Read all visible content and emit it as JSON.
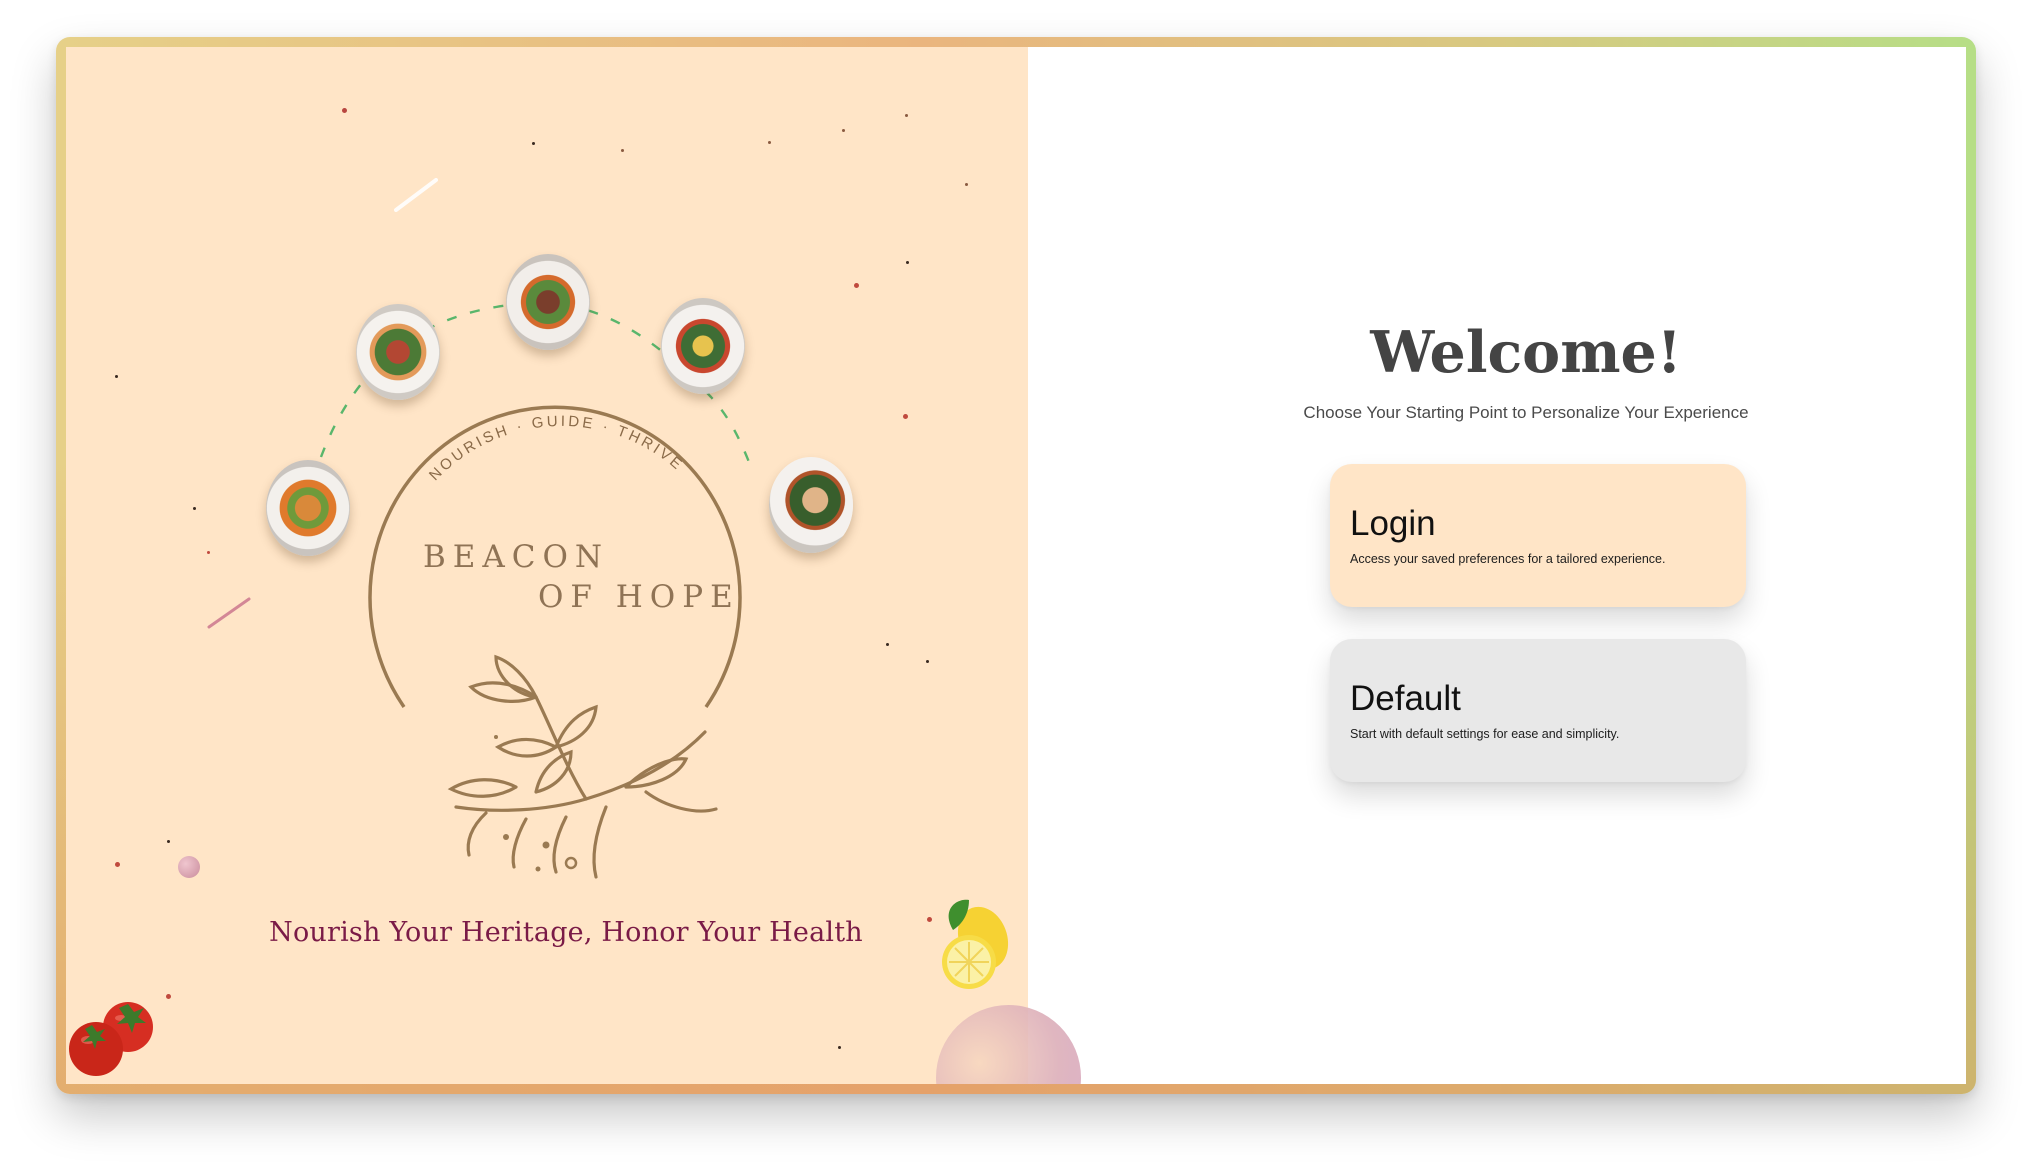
{
  "logo": {
    "brand_line1": "BEACON",
    "brand_line2": "OF HOPE",
    "arc_text": "NOURISH · GUIDE · THRIVE"
  },
  "left_panel": {
    "tagline": "Nourish Your Heritage, Honor Your Health",
    "background_color": "#ffe5c7",
    "accent_color": "#7a1b47"
  },
  "main": {
    "heading": "Welcome!",
    "subtitle": "Choose Your Starting Point to Personalize Your Experience",
    "options": [
      {
        "title": "Login",
        "description": "Access your saved preferences for a tailored experience.",
        "color": "#ffe5c7"
      },
      {
        "title": "Default",
        "description": "Start with default settings for ease and simplicity.",
        "color": "#e8e8e8"
      }
    ]
  },
  "icons": {
    "plates": [
      "food-plate-icon",
      "food-plate-icon",
      "food-plate-icon",
      "food-plate-icon",
      "food-plate-icon"
    ],
    "decor": [
      "tomato-icon",
      "lemon-icon",
      "sprig-icon"
    ]
  }
}
